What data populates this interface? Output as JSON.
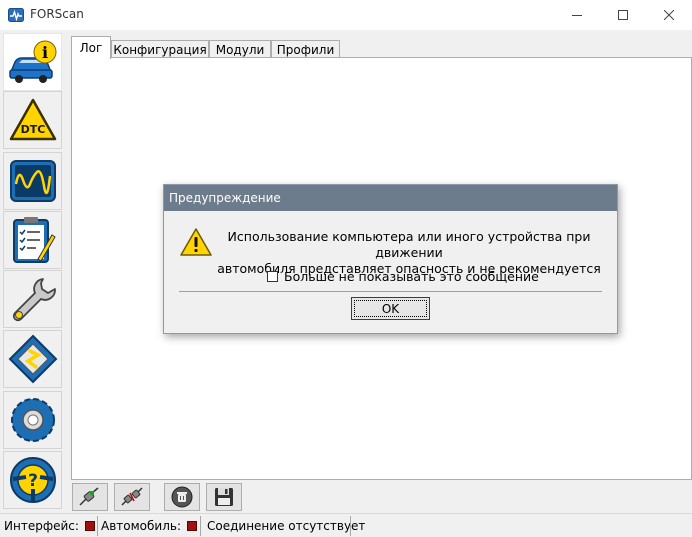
{
  "window": {
    "title": "FORScan",
    "controls": [
      "minimize-icon",
      "maximize-icon",
      "close-icon"
    ]
  },
  "sidebar": {
    "items": [
      {
        "name": "vehicle-info",
        "icon": "car-info-icon",
        "active": true
      },
      {
        "name": "dtc",
        "icon": "dtc-warning-icon",
        "label": "DTC"
      },
      {
        "name": "oscilloscope",
        "icon": "oscilloscope-icon"
      },
      {
        "name": "tests",
        "icon": "checklist-icon"
      },
      {
        "name": "service",
        "icon": "wrench-icon"
      },
      {
        "name": "configuration",
        "icon": "chip-icon"
      },
      {
        "name": "settings",
        "icon": "gear-icon"
      },
      {
        "name": "help",
        "icon": "steering-help-icon"
      }
    ]
  },
  "tabs": [
    {
      "label": "Лог",
      "active": true
    },
    {
      "label": "Конфигурация",
      "active": false
    },
    {
      "label": "Модули",
      "active": false
    },
    {
      "label": "Профили",
      "active": false
    }
  ],
  "toolbar": {
    "buttons": [
      "connect-icon",
      "disconnect-icon",
      "clear-log-icon",
      "save-icon"
    ]
  },
  "status": {
    "interface_label": "Интерфейс:",
    "vehicle_label": "Автомобиль:",
    "connection_text": "Соединение отсутствует",
    "led_color": "#a01010"
  },
  "dialog": {
    "title": "Предупреждение",
    "message_line1": "Использование компьютера или иного устройства при движении",
    "message_line2": "автомобиля представляет опасность и не рекомендуется",
    "checkbox_label": "Больше не показывать это сообщение",
    "checkbox_checked": false,
    "ok_label": "OK"
  }
}
